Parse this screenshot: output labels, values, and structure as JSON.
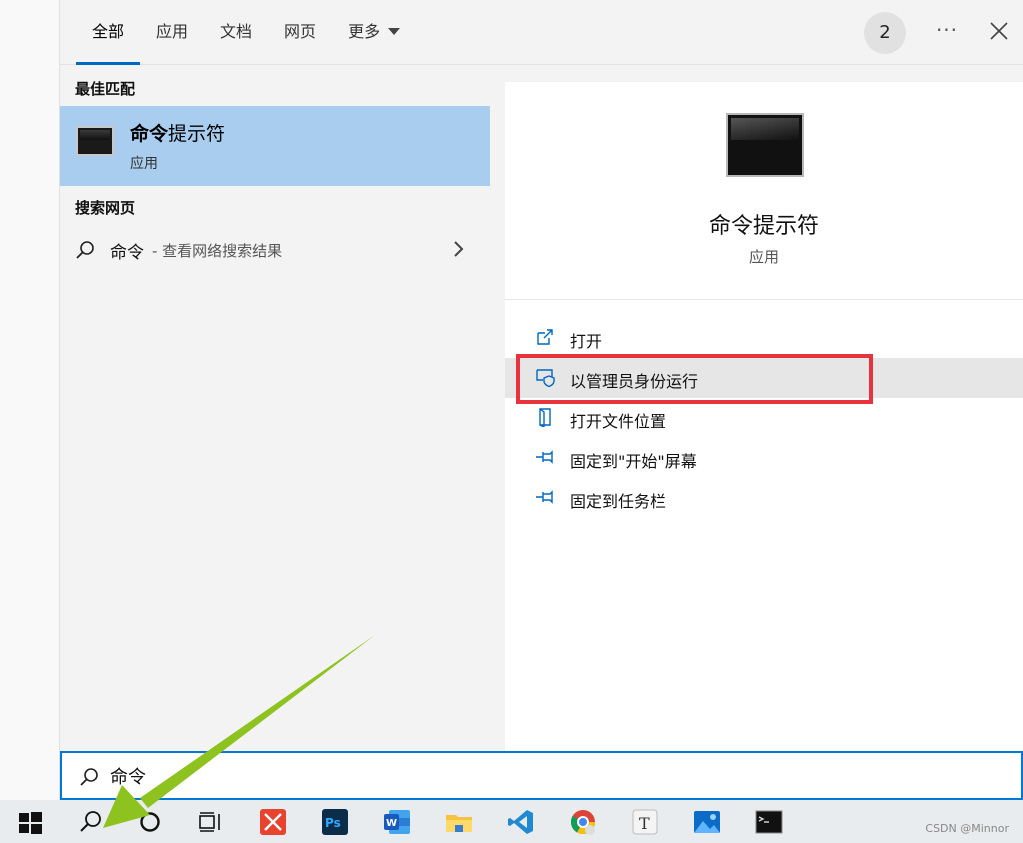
{
  "tabs": [
    {
      "label": "全部",
      "active": true
    },
    {
      "label": "应用"
    },
    {
      "label": "文档"
    },
    {
      "label": "网页"
    },
    {
      "label": "更多"
    }
  ],
  "header": {
    "badge": "2",
    "more_label": "···"
  },
  "best_match": {
    "section_label": "最佳匹配",
    "title_bold": "命令",
    "title_rest": "提示符",
    "subtitle": "应用"
  },
  "web": {
    "section_label": "搜索网页",
    "query": "命令",
    "hint": "- 查看网络搜索结果"
  },
  "detail": {
    "title": "命令提示符",
    "subtitle": "应用",
    "actions": [
      {
        "label": "打开",
        "icon": "open-icon"
      },
      {
        "label": "以管理员身份运行",
        "icon": "admin-shield-icon",
        "highlighted": true
      },
      {
        "label": "打开文件位置",
        "icon": "file-location-icon"
      },
      {
        "label": "固定到\"开始\"屏幕",
        "icon": "pin-icon"
      },
      {
        "label": "固定到任务栏",
        "icon": "pin-icon"
      }
    ]
  },
  "search": {
    "value": "命令"
  },
  "taskbar": {
    "items": [
      "windows-start-icon",
      "search-icon",
      "cortana-icon",
      "task-view-icon",
      "xmind-icon",
      "photoshop-icon",
      "word-icon",
      "file-explorer-icon",
      "vscode-icon",
      "chrome-icon",
      "typora-icon",
      "photos-icon",
      "cmd-icon"
    ],
    "watermark": "CSDN @Minnor"
  },
  "colors": {
    "accent": "#0067c0",
    "selection": "#a8cdee",
    "highlight_box": "#e8323c",
    "arrow": "#8dc21f"
  }
}
